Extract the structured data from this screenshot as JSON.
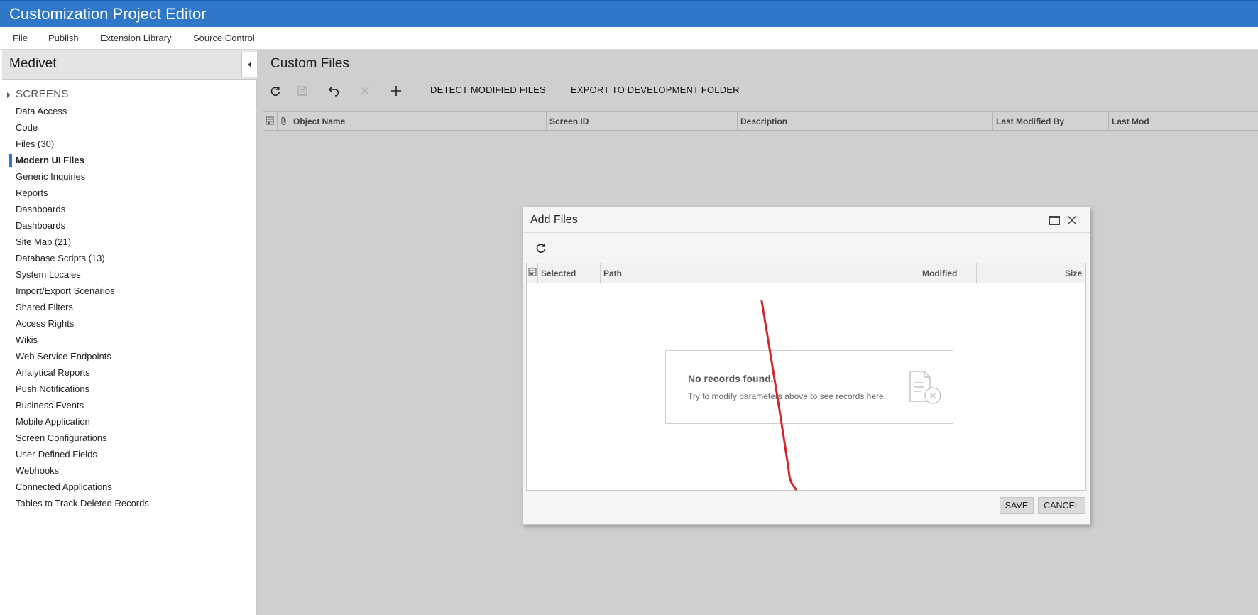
{
  "app": {
    "title": "Customization Project Editor"
  },
  "menu": {
    "items": [
      "File",
      "Publish",
      "Extension Library",
      "Source Control"
    ]
  },
  "sidebar": {
    "project_name": "Medivet",
    "screens_label": "SCREENS",
    "active_index": 3,
    "items": [
      "Data Access",
      "Code",
      "Files (30)",
      "Modern UI Files",
      "Generic Inquiries",
      "Reports",
      "Dashboards",
      "Dashboards",
      "Site Map (21)",
      "Database Scripts (13)",
      "System Locales",
      "Import/Export Scenarios",
      "Shared Filters",
      "Access Rights",
      "Wikis",
      "Web Service Endpoints",
      "Analytical Reports",
      "Push Notifications",
      "Business Events",
      "Mobile Application",
      "Screen Configurations",
      "User-Defined Fields",
      "Webhooks",
      "Connected Applications",
      "Tables to Track Deleted Records"
    ]
  },
  "main": {
    "title": "Custom Files",
    "toolbar": {
      "icons": [
        "refresh-icon",
        "save-icon",
        "undo-icon",
        "delete-icon",
        "add-icon"
      ],
      "detect_label": "DETECT MODIFIED FILES",
      "export_label": "EXPORT TO DEVELOPMENT FOLDER"
    },
    "grid_columns": [
      "Object Name",
      "Screen ID",
      "Description",
      "Last Modified By",
      "Last Mod"
    ]
  },
  "dialog": {
    "title": "Add Files",
    "columns": [
      "Selected",
      "Path",
      "Modified",
      "Size"
    ],
    "empty_title": "No records found.",
    "empty_message": "Try to modify parameters above to see records here.",
    "save_label": "SAVE",
    "cancel_label": "CANCEL"
  },
  "colors": {
    "accent": "#2f78c9",
    "annotation": "#d3262b"
  }
}
